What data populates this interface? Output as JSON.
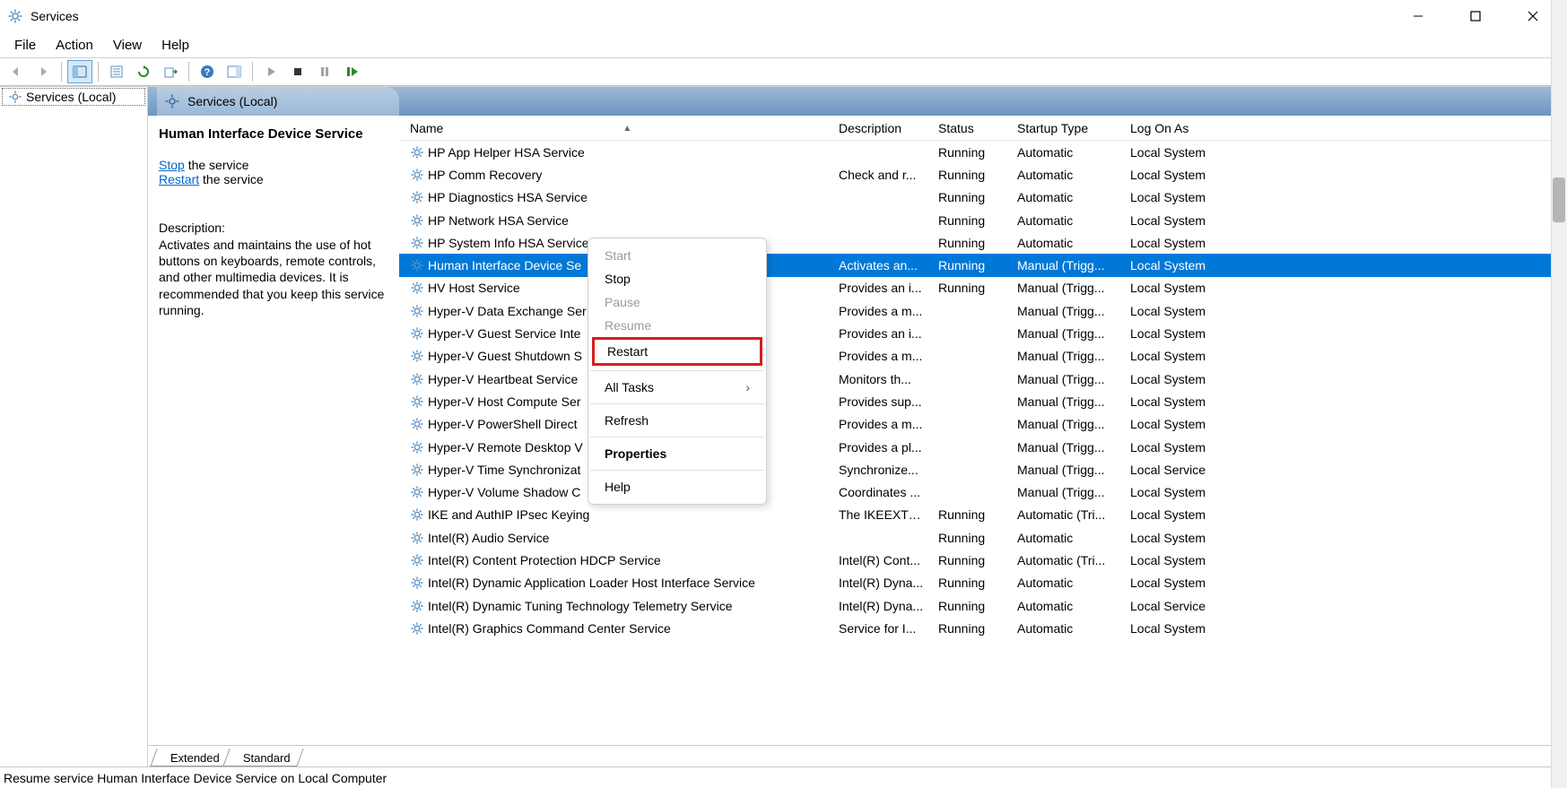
{
  "window": {
    "title": "Services"
  },
  "menu": [
    "File",
    "Action",
    "View",
    "Help"
  ],
  "tree": {
    "root": "Services (Local)"
  },
  "contentHeader": "Services (Local)",
  "detail": {
    "title": "Human Interface Device Service",
    "stopLink": "Stop",
    "stopSuffix": " the service",
    "restartLink": "Restart",
    "restartSuffix": " the service",
    "descLabel": "Description:",
    "descText": "Activates and maintains the use of hot buttons on keyboards, remote controls, and other multimedia devices. It is recommended that you keep this service running."
  },
  "columns": {
    "name": "Name",
    "description": "Description",
    "status": "Status",
    "startup": "Startup Type",
    "logon": "Log On As"
  },
  "rows": [
    {
      "name": "HP App Helper HSA Service",
      "desc": "",
      "status": "Running",
      "startup": "Automatic",
      "logon": "Local System"
    },
    {
      "name": "HP Comm Recovery",
      "desc": "Check and r...",
      "status": "Running",
      "startup": "Automatic",
      "logon": "Local System"
    },
    {
      "name": "HP Diagnostics HSA Service",
      "desc": "",
      "status": "Running",
      "startup": "Automatic",
      "logon": "Local System"
    },
    {
      "name": "HP Network HSA Service",
      "desc": "",
      "status": "Running",
      "startup": "Automatic",
      "logon": "Local System"
    },
    {
      "name": "HP System Info HSA Service",
      "desc": "",
      "status": "Running",
      "startup": "Automatic",
      "logon": "Local System"
    },
    {
      "name": "Human Interface Device Service",
      "desc": "Activates an...",
      "status": "Running",
      "startup": "Manual (Trigg...",
      "logon": "Local System",
      "selected": true,
      "truncName": "Human Interface Device Se"
    },
    {
      "name": "HV Host Service",
      "desc": "Provides an i...",
      "status": "Running",
      "startup": "Manual (Trigg...",
      "logon": "Local System"
    },
    {
      "name": "Hyper-V Data Exchange Service",
      "desc": "Provides a m...",
      "status": "",
      "startup": "Manual (Trigg...",
      "logon": "Local System",
      "truncName": "Hyper-V Data Exchange Ser"
    },
    {
      "name": "Hyper-V Guest Service Interface",
      "desc": "Provides an i...",
      "status": "",
      "startup": "Manual (Trigg...",
      "logon": "Local System",
      "truncName": "Hyper-V Guest Service Inte"
    },
    {
      "name": "Hyper-V Guest Shutdown Service",
      "desc": "Provides a m...",
      "status": "",
      "startup": "Manual (Trigg...",
      "logon": "Local System",
      "truncName": "Hyper-V Guest Shutdown S"
    },
    {
      "name": "Hyper-V Heartbeat Service",
      "desc": "Monitors th...",
      "status": "",
      "startup": "Manual (Trigg...",
      "logon": "Local System"
    },
    {
      "name": "Hyper-V Host Compute Service",
      "desc": "Provides sup...",
      "status": "",
      "startup": "Manual (Trigg...",
      "logon": "Local System",
      "truncName": "Hyper-V Host Compute Ser"
    },
    {
      "name": "Hyper-V PowerShell Direct Service",
      "desc": "Provides a m...",
      "status": "",
      "startup": "Manual (Trigg...",
      "logon": "Local System",
      "truncName": "Hyper-V PowerShell Direct"
    },
    {
      "name": "Hyper-V Remote Desktop Virtualization Service",
      "desc": "Provides a pl...",
      "status": "",
      "startup": "Manual (Trigg...",
      "logon": "Local System",
      "truncName": "Hyper-V Remote Desktop V"
    },
    {
      "name": "Hyper-V Time Synchronization Service",
      "desc": "Synchronize...",
      "status": "",
      "startup": "Manual (Trigg...",
      "logon": "Local Service",
      "truncName": "Hyper-V Time Synchronizat"
    },
    {
      "name": "Hyper-V Volume Shadow Copy Requestor",
      "desc": "Coordinates ...",
      "status": "",
      "startup": "Manual (Trigg...",
      "logon": "Local System",
      "truncName": "Hyper-V Volume Shadow C"
    },
    {
      "name": "IKE and AuthIP IPsec Keying Modules",
      "desc": "The IKEEXT s...",
      "status": "Running",
      "startup": "Automatic (Tri...",
      "logon": "Local System",
      "truncName": "IKE and AuthIP IPsec Keying"
    },
    {
      "name": "Intel(R) Audio Service",
      "desc": "",
      "status": "Running",
      "startup": "Automatic",
      "logon": "Local System"
    },
    {
      "name": "Intel(R) Content Protection HDCP Service",
      "desc": "Intel(R) Cont...",
      "status": "Running",
      "startup": "Automatic (Tri...",
      "logon": "Local System"
    },
    {
      "name": "Intel(R) Dynamic Application Loader Host Interface Service",
      "desc": "Intel(R) Dyna...",
      "status": "Running",
      "startup": "Automatic",
      "logon": "Local System"
    },
    {
      "name": "Intel(R) Dynamic Tuning Technology Telemetry Service",
      "desc": "Intel(R) Dyna...",
      "status": "Running",
      "startup": "Automatic",
      "logon": "Local Service"
    },
    {
      "name": "Intel(R) Graphics Command Center Service",
      "desc": "Service for I...",
      "status": "Running",
      "startup": "Automatic",
      "logon": "Local System"
    }
  ],
  "contextMenu": {
    "start": "Start",
    "stop": "Stop",
    "pause": "Pause",
    "resume": "Resume",
    "restart": "Restart",
    "allTasks": "All Tasks",
    "refresh": "Refresh",
    "properties": "Properties",
    "help": "Help"
  },
  "tabs": {
    "extended": "Extended",
    "standard": "Standard"
  },
  "statusbar": "Resume service Human Interface Device Service on Local Computer"
}
